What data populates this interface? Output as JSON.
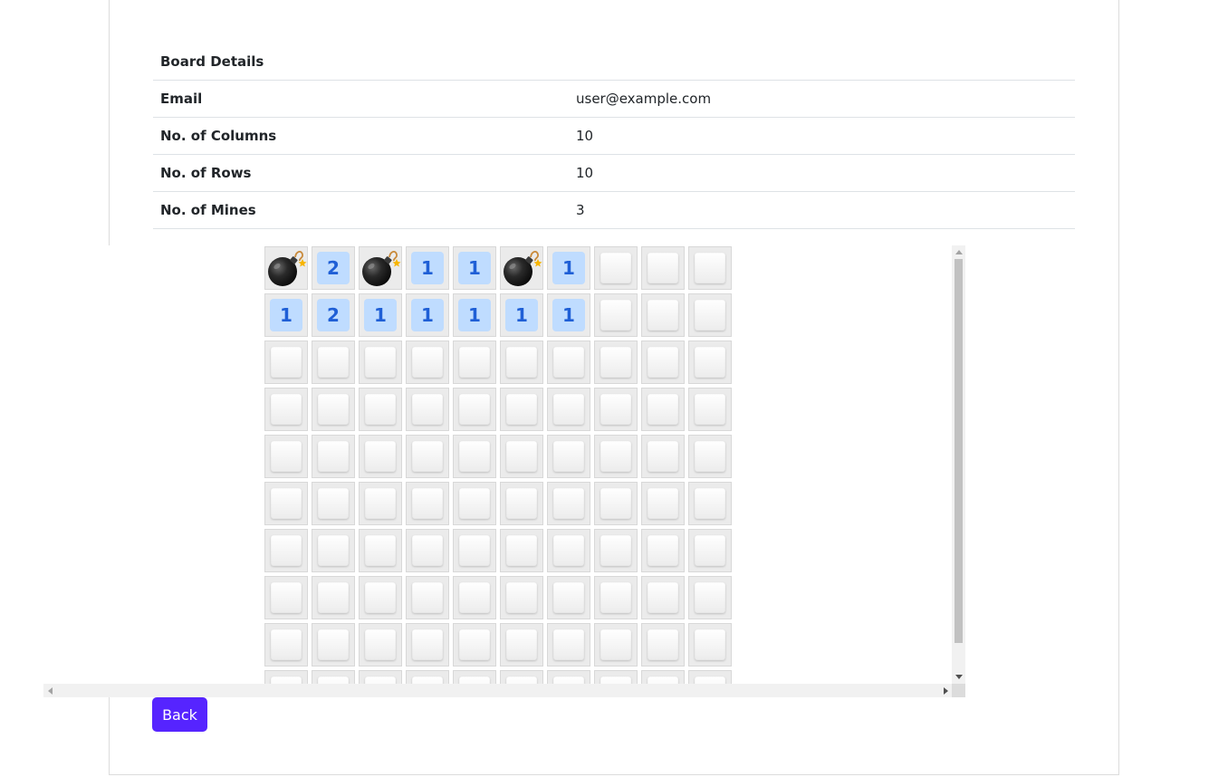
{
  "details": {
    "heading": "Board Details",
    "rows": [
      {
        "label": "Email",
        "value": "user@example.com"
      },
      {
        "label": "No. of Columns",
        "value": "10"
      },
      {
        "label": "No. of Rows",
        "value": "10"
      },
      {
        "label": "No. of Mines",
        "value": "3"
      }
    ]
  },
  "board": {
    "columns": 10,
    "rows": 10,
    "visible_rows": [
      [
        "mine",
        "2",
        "mine",
        "1",
        "1",
        "mine",
        "1",
        "closed",
        "closed",
        "closed"
      ],
      [
        "1",
        "2",
        "1",
        "1",
        "1",
        "1",
        "1",
        "closed",
        "closed",
        "closed"
      ],
      [
        "closed",
        "closed",
        "closed",
        "closed",
        "closed",
        "closed",
        "closed",
        "closed",
        "closed",
        "closed"
      ],
      [
        "closed",
        "closed",
        "closed",
        "closed",
        "closed",
        "closed",
        "closed",
        "closed",
        "closed",
        "closed"
      ],
      [
        "closed",
        "closed",
        "closed",
        "closed",
        "closed",
        "closed",
        "closed",
        "closed",
        "closed",
        "closed"
      ],
      [
        "closed",
        "closed",
        "closed",
        "closed",
        "closed",
        "closed",
        "closed",
        "closed",
        "closed",
        "closed"
      ],
      [
        "closed",
        "closed",
        "closed",
        "closed",
        "closed",
        "closed",
        "closed",
        "closed",
        "closed",
        "closed"
      ],
      [
        "closed",
        "closed",
        "closed",
        "closed",
        "closed",
        "closed",
        "closed",
        "closed",
        "closed",
        "closed"
      ],
      [
        "closed",
        "closed",
        "closed",
        "closed",
        "closed",
        "closed",
        "closed",
        "closed",
        "closed",
        "closed"
      ],
      [
        "closed",
        "closed",
        "closed",
        "closed",
        "closed",
        "closed",
        "closed",
        "closed",
        "closed",
        "closed"
      ]
    ],
    "mine_icon": "bomb-icon",
    "number_color": "#1f5fd6",
    "revealed_bg": "#bfdcff"
  },
  "actions": {
    "back_label": "Back",
    "back_color": "#5624ff"
  }
}
